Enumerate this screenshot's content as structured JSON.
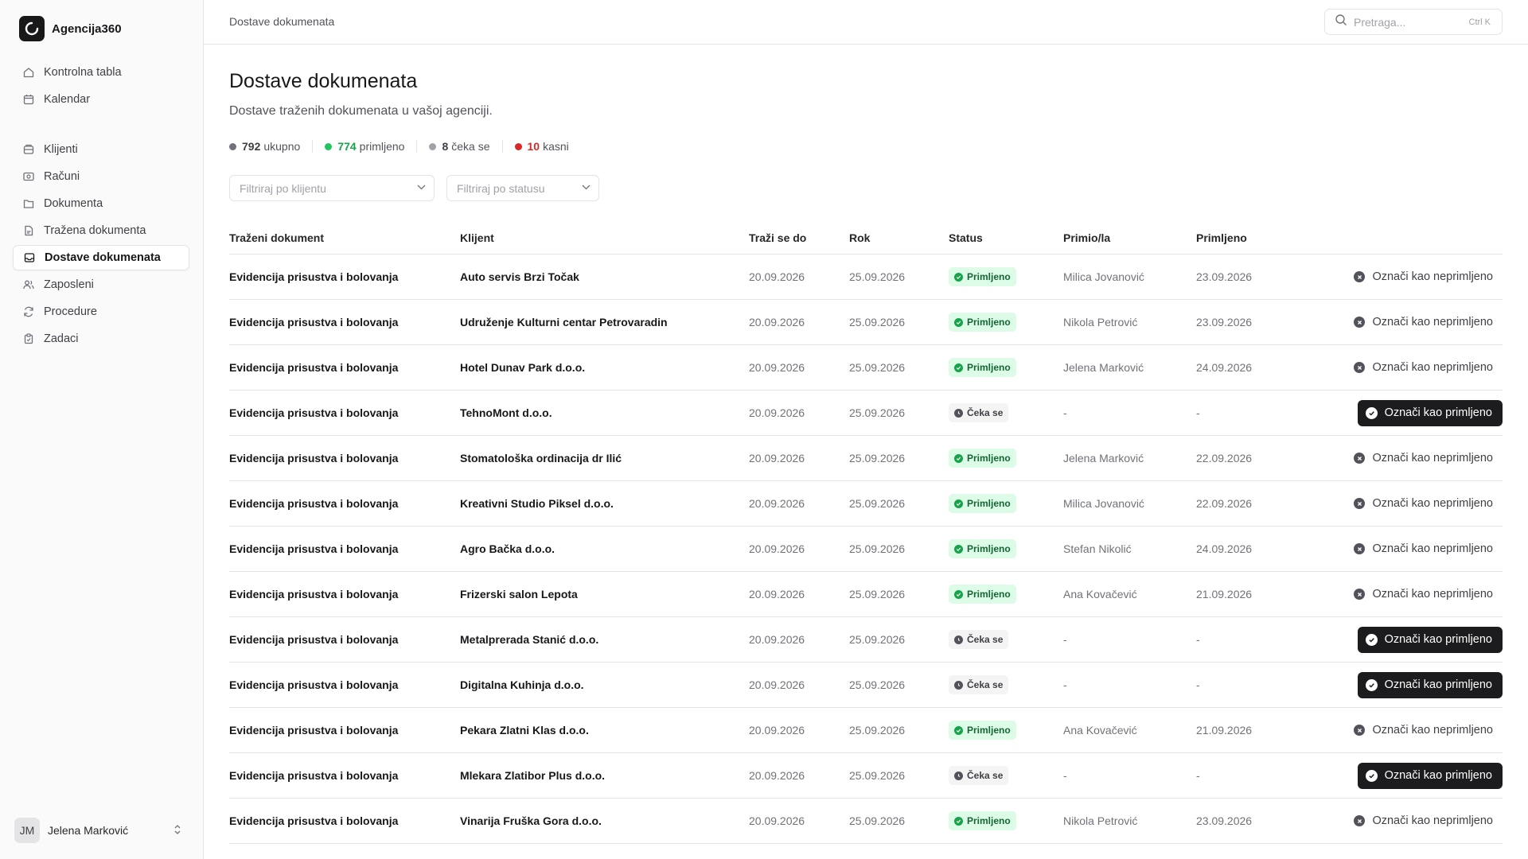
{
  "app": {
    "name": "Agencija360",
    "logo_icon": "logo-icon"
  },
  "sidebar": {
    "top_items": [
      {
        "label": "Kontrolna tabla",
        "icon": "home-icon"
      },
      {
        "label": "Kalendar",
        "icon": "calendar-icon"
      }
    ],
    "main_items": [
      {
        "label": "Klijenti",
        "icon": "clients-icon"
      },
      {
        "label": "Računi",
        "icon": "invoice-icon"
      },
      {
        "label": "Dokumenta",
        "icon": "folder-icon"
      },
      {
        "label": "Tražena dokumenta",
        "icon": "doc-request-icon"
      },
      {
        "label": "Dostave dokumenata",
        "icon": "inbox-icon",
        "active": true
      },
      {
        "label": "Zaposleni",
        "icon": "users-icon"
      },
      {
        "label": "Procedure",
        "icon": "refresh-icon"
      },
      {
        "label": "Zadaci",
        "icon": "clipboard-icon"
      }
    ],
    "user": {
      "initials": "JM",
      "name": "Jelena Marković"
    }
  },
  "topbar": {
    "breadcrumb": "Dostave dokumenata",
    "search_placeholder": "Pretraga...",
    "search_shortcut": "Ctrl K"
  },
  "page": {
    "title": "Dostave dokumenata",
    "subtitle": "Dostave traženih dokumenata u vašoj agenciji."
  },
  "stats": [
    {
      "value": "792",
      "label": "ukupno",
      "color": "#71717a",
      "num_color": "#3f3f46"
    },
    {
      "value": "774",
      "label": "primljeno",
      "color": "#22c55e",
      "num_color": "#16a34a"
    },
    {
      "value": "8",
      "label": "čeka se",
      "color": "#a1a1aa",
      "num_color": "#3f3f46"
    },
    {
      "value": "10",
      "label": "kasni",
      "color": "#dc2626",
      "num_color": "#dc2626"
    }
  ],
  "filters": {
    "client_placeholder": "Filtriraj po klijentu",
    "status_placeholder": "Filtriraj po statusu"
  },
  "table": {
    "headers": {
      "document": "Traženi dokument",
      "client": "Klijent",
      "requested_until": "Traži se do",
      "due": "Rok",
      "status": "Status",
      "received_by": "Primio/la",
      "received": "Primljeno"
    },
    "status_labels": {
      "received": "Primljeno",
      "waiting": "Čeka se"
    },
    "action_labels": {
      "mark_received": "Označi kao primljeno",
      "mark_unreceived": "Označi kao neprimljeno"
    },
    "rows": [
      {
        "document": "Evidencija prisustva i bolovanja",
        "client": "Auto servis Brzi Točak",
        "requested_until": "20.09.2026",
        "due": "25.09.2026",
        "status": "received",
        "received_by": "Milica Jovanović",
        "received": "23.09.2026"
      },
      {
        "document": "Evidencija prisustva i bolovanja",
        "client": "Udruženje Kulturni centar Petrovaradin",
        "requested_until": "20.09.2026",
        "due": "25.09.2026",
        "status": "received",
        "received_by": "Nikola Petrović",
        "received": "23.09.2026"
      },
      {
        "document": "Evidencija prisustva i bolovanja",
        "client": "Hotel Dunav Park d.o.o.",
        "requested_until": "20.09.2026",
        "due": "25.09.2026",
        "status": "received",
        "received_by": "Jelena Marković",
        "received": "24.09.2026"
      },
      {
        "document": "Evidencija prisustva i bolovanja",
        "client": "TehnoMont d.o.o.",
        "requested_until": "20.09.2026",
        "due": "25.09.2026",
        "status": "waiting",
        "received_by": "-",
        "received": "-"
      },
      {
        "document": "Evidencija prisustva i bolovanja",
        "client": "Stomatološka ordinacija dr Ilić",
        "requested_until": "20.09.2026",
        "due": "25.09.2026",
        "status": "received",
        "received_by": "Jelena Marković",
        "received": "22.09.2026"
      },
      {
        "document": "Evidencija prisustva i bolovanja",
        "client": "Kreativni Studio Piksel d.o.o.",
        "requested_until": "20.09.2026",
        "due": "25.09.2026",
        "status": "received",
        "received_by": "Milica Jovanović",
        "received": "22.09.2026"
      },
      {
        "document": "Evidencija prisustva i bolovanja",
        "client": "Agro Bačka d.o.o.",
        "requested_until": "20.09.2026",
        "due": "25.09.2026",
        "status": "received",
        "received_by": "Stefan Nikolić",
        "received": "24.09.2026"
      },
      {
        "document": "Evidencija prisustva i bolovanja",
        "client": "Frizerski salon Lepota",
        "requested_until": "20.09.2026",
        "due": "25.09.2026",
        "status": "received",
        "received_by": "Ana Kovačević",
        "received": "21.09.2026"
      },
      {
        "document": "Evidencija prisustva i bolovanja",
        "client": "Metalprerada Stanić d.o.o.",
        "requested_until": "20.09.2026",
        "due": "25.09.2026",
        "status": "waiting",
        "received_by": "-",
        "received": "-"
      },
      {
        "document": "Evidencija prisustva i bolovanja",
        "client": "Digitalna Kuhinja d.o.o.",
        "requested_until": "20.09.2026",
        "due": "25.09.2026",
        "status": "waiting",
        "received_by": "-",
        "received": "-"
      },
      {
        "document": "Evidencija prisustva i bolovanja",
        "client": "Pekara Zlatni Klas d.o.o.",
        "requested_until": "20.09.2026",
        "due": "25.09.2026",
        "status": "received",
        "received_by": "Ana Kovačević",
        "received": "21.09.2026"
      },
      {
        "document": "Evidencija prisustva i bolovanja",
        "client": "Mlekara Zlatibor Plus d.o.o.",
        "requested_until": "20.09.2026",
        "due": "25.09.2026",
        "status": "waiting",
        "received_by": "-",
        "received": "-"
      },
      {
        "document": "Evidencija prisustva i bolovanja",
        "client": "Vinarija Fruška Gora d.o.o.",
        "requested_until": "20.09.2026",
        "due": "25.09.2026",
        "status": "received",
        "received_by": "Nikola Petrović",
        "received": "23.09.2026"
      }
    ]
  }
}
